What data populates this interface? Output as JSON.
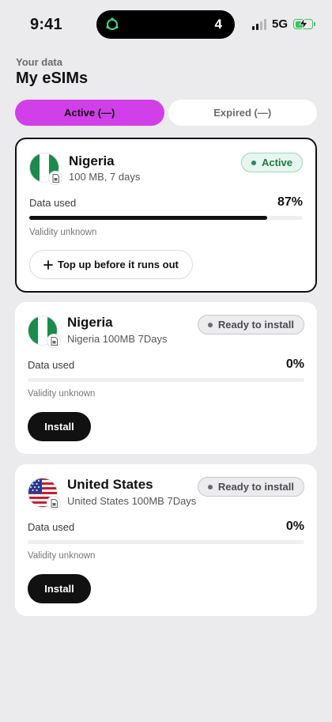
{
  "status_bar": {
    "time": "9:41",
    "island_count": "4",
    "network": "5G",
    "icons": [
      "signal-icon",
      "battery-charging-icon",
      "island-app-icon"
    ],
    "colors": {
      "battery": "#35c759"
    }
  },
  "header": {
    "subtitle": "Your data",
    "title": "My eSIMs"
  },
  "tabs": [
    {
      "label": "Active (—)",
      "selected": true
    },
    {
      "label": "Expired (—)",
      "selected": false
    }
  ],
  "colors": {
    "accent": "#d13fe8",
    "active_green": "#1f7a45",
    "dark": "#111111"
  },
  "esims": [
    {
      "country": "Nigeria",
      "plan": "100 MB, 7 days",
      "status": "Active",
      "data_used_label": "Data used",
      "usage_percent": "87%",
      "usage_fraction": 0.87,
      "validity": "Validity unknown",
      "action_label": "Top up before it runs out",
      "flag": "nigeria-flag-icon"
    },
    {
      "country": "Nigeria",
      "plan": "Nigeria 100MB 7Days",
      "status": "Ready to install",
      "data_used_label": "Data used",
      "usage_percent": "0%",
      "usage_fraction": 0,
      "validity": "Validity unknown",
      "action_label": "Install",
      "flag": "nigeria-flag-icon"
    },
    {
      "country": "United States",
      "plan": "United States 100MB 7Days",
      "status": "Ready to install",
      "data_used_label": "Data used",
      "usage_percent": "0%",
      "usage_fraction": 0,
      "validity": "Validity unknown",
      "action_label": "Install",
      "flag": "usa-flag-icon"
    }
  ]
}
